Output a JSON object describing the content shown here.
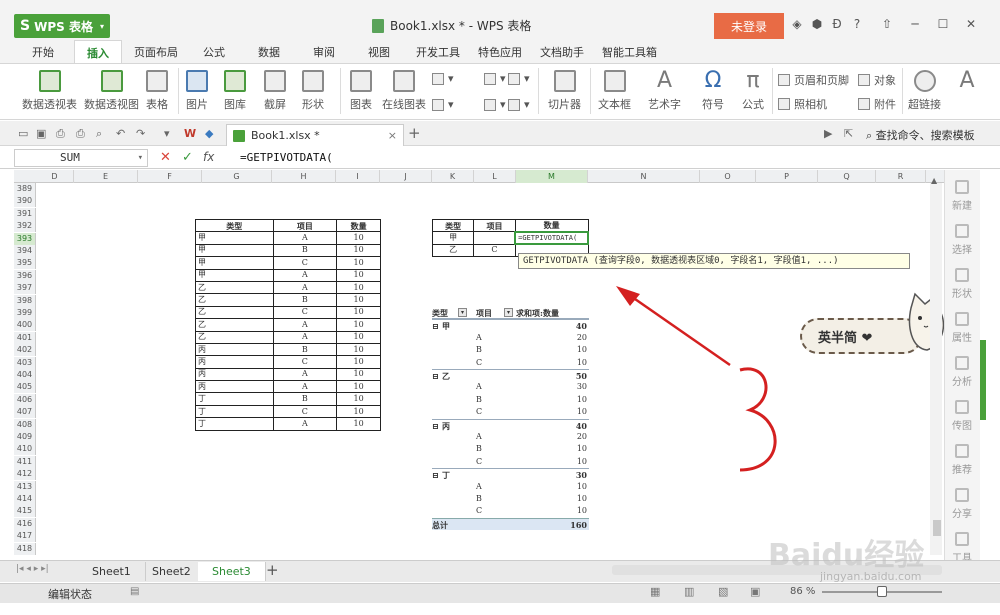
{
  "app": {
    "name": "WPS 表格",
    "window_title": "Book1.xlsx * - WPS 表格",
    "login": "未登录"
  },
  "menu_tabs": [
    "开始",
    "插入",
    "页面布局",
    "公式",
    "数据",
    "审阅",
    "视图",
    "开发工具",
    "特色应用",
    "文档助手",
    "智能工具箱"
  ],
  "ribbon": {
    "pivot_table": "数据透视表",
    "pivot_chart": "数据透视图",
    "table": "表格",
    "image": "图片",
    "gallery": "图库",
    "screenshot": "截屏",
    "shapes": "形状",
    "chart": "图表",
    "online_chart": "在线图表",
    "slicer": "切片器",
    "textbox": "文本框",
    "wordart": "艺术字",
    "symbol": "符号",
    "formula": "公式",
    "header_footer": "页眉和页脚",
    "object": "对象",
    "camera": "照相机",
    "attachment": "附件",
    "hyperlink": "超链接"
  },
  "doc_tab": "Book1.xlsx *",
  "search_cmd": "查找命令、搜索模板",
  "formula_bar": {
    "name_box": "SUM",
    "formula": "=GETPIVOTDATA("
  },
  "columns": [
    "D",
    "E",
    "F",
    "G",
    "H",
    "I",
    "J",
    "K",
    "L",
    "M",
    "N",
    "O",
    "P",
    "Q",
    "R"
  ],
  "rows": [
    "389",
    "390",
    "391",
    "392",
    "393",
    "394",
    "395",
    "396",
    "397",
    "398",
    "399",
    "400",
    "401",
    "402",
    "403",
    "404",
    "405",
    "406",
    "407",
    "408",
    "409",
    "410",
    "411",
    "412",
    "413",
    "414",
    "415",
    "416",
    "417",
    "418"
  ],
  "table1": {
    "headers": [
      "类型",
      "项目",
      "数量"
    ],
    "rows": [
      [
        "甲",
        "A",
        "10"
      ],
      [
        "甲",
        "B",
        "10"
      ],
      [
        "甲",
        "C",
        "10"
      ],
      [
        "甲",
        "A",
        "10"
      ],
      [
        "乙",
        "A",
        "10"
      ],
      [
        "乙",
        "B",
        "10"
      ],
      [
        "乙",
        "C",
        "10"
      ],
      [
        "乙",
        "A",
        "10"
      ],
      [
        "乙",
        "A",
        "10"
      ],
      [
        "丙",
        "B",
        "10"
      ],
      [
        "丙",
        "C",
        "10"
      ],
      [
        "丙",
        "A",
        "10"
      ],
      [
        "丙",
        "A",
        "10"
      ],
      [
        "丁",
        "B",
        "10"
      ],
      [
        "丁",
        "C",
        "10"
      ],
      [
        "丁",
        "A",
        "10"
      ]
    ]
  },
  "table2": {
    "headers": [
      "类型",
      "项目",
      "数量"
    ],
    "row1": [
      "甲",
      "",
      "=GETPIVOTDATA("
    ],
    "row2": [
      "乙",
      "C",
      ""
    ]
  },
  "tooltip": "GETPIVOTDATA (查询字段0, 数据透视表区域0, 字段名1, 字段值1, ...)",
  "pivot": {
    "headers": [
      "类型",
      "项目",
      "求和项:数量"
    ],
    "groups": [
      {
        "name": "甲",
        "total": "40",
        "items": [
          [
            "A",
            "20"
          ],
          [
            "B",
            "10"
          ],
          [
            "C",
            "10"
          ]
        ]
      },
      {
        "name": "乙",
        "total": "50",
        "items": [
          [
            "A",
            "30"
          ],
          [
            "B",
            "10"
          ],
          [
            "C",
            "10"
          ]
        ]
      },
      {
        "name": "丙",
        "total": "40",
        "items": [
          [
            "A",
            "20"
          ],
          [
            "B",
            "10"
          ],
          [
            "C",
            "10"
          ]
        ]
      },
      {
        "name": "丁",
        "total": "30",
        "items": [
          [
            "A",
            "10"
          ],
          [
            "B",
            "10"
          ],
          [
            "C",
            "10"
          ]
        ]
      }
    ],
    "grand_total_label": "总计",
    "grand_total": "160"
  },
  "sticker": "英半简 ❤",
  "side_panel": [
    "新建",
    "选择",
    "形状",
    "属性",
    "分析",
    "传图",
    "推荐",
    "分享",
    "工具"
  ],
  "sheet_tabs": [
    "Sheet1",
    "Sheet2",
    "Sheet3"
  ],
  "active_sheet": "Sheet3",
  "status": "编辑状态",
  "zoom": "86 %",
  "watermark": "Baidu经验",
  "watermark_url": "jingyan.baidu.com",
  "colors": {
    "accent": "#4aa13a",
    "login": "#e86b45",
    "arrow": "#d42020"
  }
}
